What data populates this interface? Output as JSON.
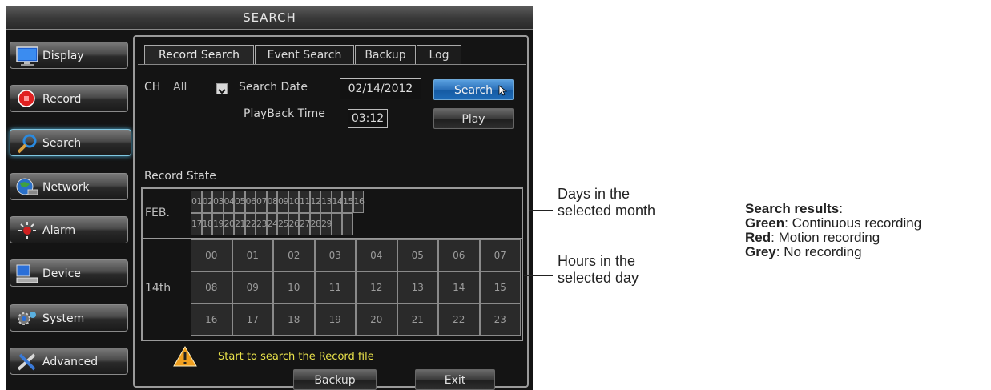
{
  "window": {
    "title": "SEARCH"
  },
  "sidebar": {
    "items": [
      {
        "label": "Display",
        "icon": "monitor-icon"
      },
      {
        "label": "Record",
        "icon": "record-icon"
      },
      {
        "label": "Search",
        "icon": "magnifier-icon",
        "active": true
      },
      {
        "label": "Network",
        "icon": "globe-network-icon"
      },
      {
        "label": "Alarm",
        "icon": "alarm-icon"
      },
      {
        "label": "Device",
        "icon": "device-icon"
      },
      {
        "label": "System",
        "icon": "system-gear-icon"
      },
      {
        "label": "Advanced",
        "icon": "tools-icon"
      }
    ]
  },
  "tabs": [
    {
      "label": "Record Search",
      "active": true
    },
    {
      "label": "Event Search"
    },
    {
      "label": "Backup"
    },
    {
      "label": "Log"
    }
  ],
  "form": {
    "ch_label": "CH",
    "ch_value": "All",
    "search_date_label": "Search Date",
    "search_date_value": "02/14/2012",
    "search_button": "Search",
    "playback_time_label": "PlayBack Time",
    "playback_time_value": "03:12",
    "play_button": "Play"
  },
  "record_state": {
    "heading": "Record State",
    "month_label": "FEB.",
    "days_row1": [
      "01",
      "02",
      "03",
      "04",
      "05",
      "06",
      "07",
      "08",
      "09",
      "10",
      "11",
      "12",
      "13",
      "14",
      "15",
      "16"
    ],
    "days_row2": [
      "17",
      "18",
      "19",
      "20",
      "21",
      "22",
      "23",
      "24",
      "25",
      "26",
      "27",
      "28",
      "29",
      "",
      ""
    ],
    "day_label": "14th",
    "hours": [
      [
        "00",
        "01",
        "02",
        "03",
        "04",
        "05",
        "06",
        "07"
      ],
      [
        "08",
        "09",
        "10",
        "11",
        "12",
        "13",
        "14",
        "15"
      ],
      [
        "16",
        "17",
        "18",
        "19",
        "20",
        "21",
        "22",
        "23"
      ]
    ]
  },
  "status": {
    "message": "Start to search the Record file",
    "color": "#e8e14a"
  },
  "footer": {
    "backup_button": "Backup",
    "exit_button": "Exit"
  },
  "annotations": {
    "days_line1": "Days in the",
    "days_line2": "selected month",
    "hours_line1": "Hours in the",
    "hours_line2": "selected day",
    "legend_title": "Search results",
    "legend_title_suffix": ":",
    "legend_green_key": "Green",
    "legend_green_text": ": Continuous recording",
    "legend_red_key": "Red",
    "legend_red_text": ": Motion recording",
    "legend_grey_key": "Grey",
    "legend_grey_text": ": No recording"
  },
  "colors": {
    "accent_blue": "#2a6fb8",
    "status_yellow": "#e8e14a",
    "warning_orange": "#f0a020"
  }
}
